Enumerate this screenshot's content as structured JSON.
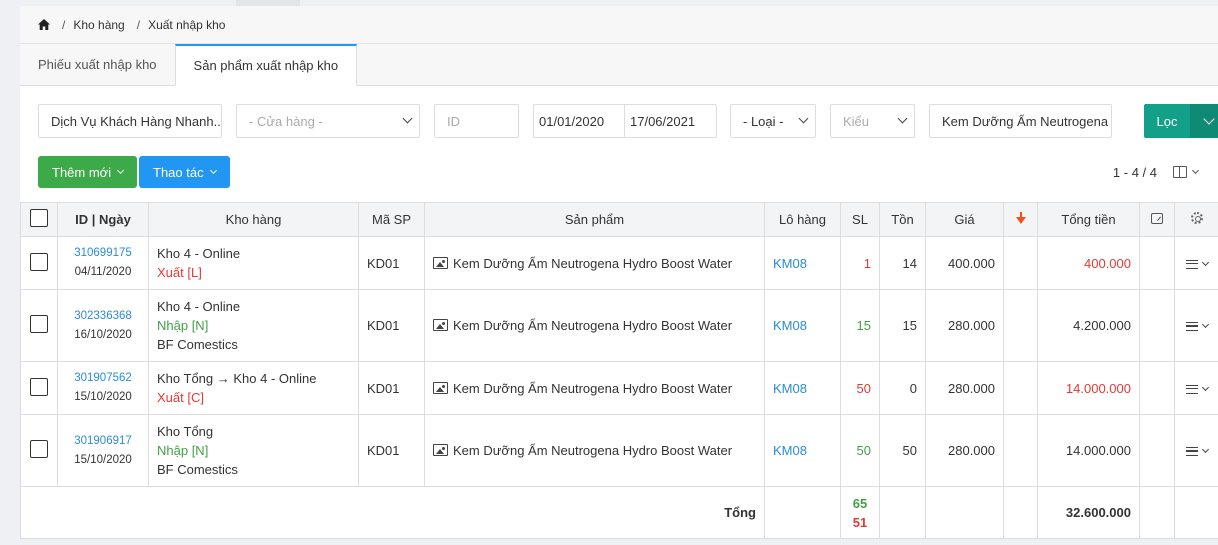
{
  "breadcrumb": {
    "items": [
      "Kho hàng",
      "Xuất nhập kho"
    ]
  },
  "tabs": [
    "Phiếu xuất nhập kho",
    "Sản phẩm xuất nhập kho"
  ],
  "filters": {
    "company": "Dịch Vụ Khách Hàng Nhanh...",
    "store_placeholder": "- Cửa hàng -",
    "id_placeholder": "ID",
    "date_from": "01/01/2020",
    "date_to": "17/06/2021",
    "type_placeholder": "- Loại -",
    "kind_placeholder": "Kiểu",
    "product": "Kem Dưỡng Ẩm Neutrogena",
    "filter_button": "Lọc"
  },
  "actions": {
    "add_new": "Thêm mới",
    "operations": "Thao tác",
    "pager": "1 - 4 / 4"
  },
  "table": {
    "headers": [
      "ID | Ngày",
      "Kho hàng",
      "Mã SP",
      "Sản phẩm",
      "Lô hàng",
      "SL",
      "Tồn",
      "Giá",
      "Tổng tiền"
    ],
    "rows": [
      {
        "id": "310699175",
        "date": "04/11/2020",
        "warehouse": "Kho 4 - Online",
        "type": "Xuất [L]",
        "supplier": "",
        "sku": "KD01",
        "product": "Kem Dưỡng Ẩm Neutrogena Hydro Boost Water",
        "lot": "KM08",
        "qty": "1",
        "stock": "14",
        "price": "400.000",
        "total": "400.000"
      },
      {
        "id": "302336368",
        "date": "16/10/2020",
        "warehouse": "Kho 4 - Online",
        "type": "Nhập [N]",
        "supplier": "BF Comestics",
        "sku": "KD01",
        "product": "Kem Dưỡng Ẩm Neutrogena Hydro Boost Water",
        "lot": "KM08",
        "qty": "15",
        "stock": "15",
        "price": "280.000",
        "total": "4.200.000"
      },
      {
        "id": "301907562",
        "date": "15/10/2020",
        "warehouse": "Kho Tổng → Kho 4 - Online",
        "type": "Xuất [C]",
        "supplier": "",
        "sku": "KD01",
        "product": "Kem Dưỡng Ẩm Neutrogena Hydro Boost Water",
        "lot": "KM08",
        "qty": "50",
        "stock": "0",
        "price": "280.000",
        "total": "14.000.000"
      },
      {
        "id": "301906917",
        "date": "15/10/2020",
        "warehouse": "Kho Tổng",
        "type": "Nhập [N]",
        "supplier": "BF Comestics",
        "sku": "KD01",
        "product": "Kem Dưỡng Ẩm Neutrogena Hydro Boost Water",
        "lot": "KM08",
        "qty": "50",
        "stock": "50",
        "price": "280.000",
        "total": "14.000.000"
      }
    ],
    "footer": {
      "label": "Tổng",
      "qty_in": "65",
      "qty_out": "51",
      "total": "32.600.000"
    }
  },
  "colors": {
    "accent": "#2196f3",
    "filter_button": "#13a089",
    "add_button": "#3daa4a",
    "out": "#e53935",
    "in": "#43a047"
  }
}
